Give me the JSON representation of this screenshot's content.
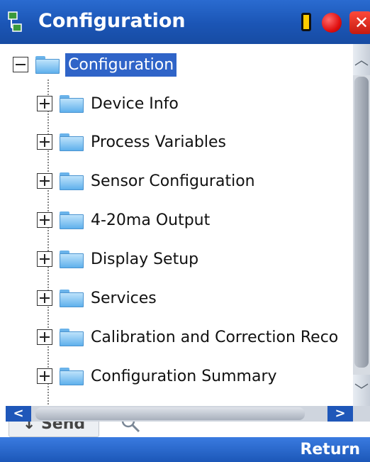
{
  "window": {
    "title": "Configuration"
  },
  "tree": {
    "root": {
      "label": "Configuration"
    },
    "items": [
      {
        "label": "Device Info"
      },
      {
        "label": "Process Variables"
      },
      {
        "label": "Sensor Configuration"
      },
      {
        "label": "4-20ma Output"
      },
      {
        "label": "Display Setup"
      },
      {
        "label": "Services"
      },
      {
        "label": "Calibration and Correction Reco"
      },
      {
        "label": "Configuration Summary"
      }
    ]
  },
  "toolbar": {
    "send_label": "↓ Send"
  },
  "softkeys": {
    "right_label": "Return"
  },
  "colors": {
    "titlebar": "#1b55b5",
    "selection": "#2f64c8",
    "softbar": "#1c57b8"
  },
  "icons": [
    "app-icon",
    "battery-icon",
    "record-icon",
    "close-icon",
    "folder-icon",
    "expand-icon",
    "collapse-icon",
    "search-icon"
  ]
}
